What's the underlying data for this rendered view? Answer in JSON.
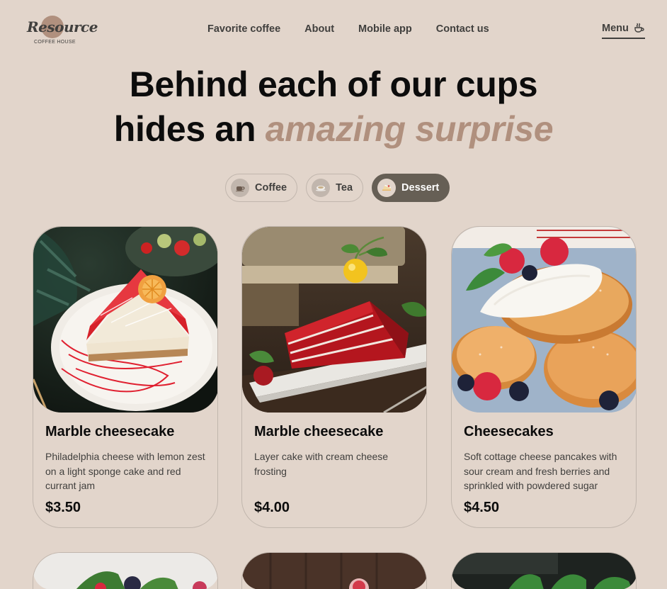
{
  "brand": {
    "name": "Resource",
    "tagline": "COFFEE HOUSE"
  },
  "nav": {
    "items": [
      "Favorite coffee",
      "About",
      "Mobile app",
      "Contact us"
    ]
  },
  "menu_button": {
    "label": "Menu"
  },
  "hero": {
    "line1": "Behind each of our cups",
    "line2_plain": "hides an ",
    "line2_accent": "amazing surprise"
  },
  "tabs": [
    {
      "label": "Coffee",
      "icon": "coffee-cup-icon",
      "active": false
    },
    {
      "label": "Tea",
      "icon": "tea-cup-icon",
      "active": false
    },
    {
      "label": "Dessert",
      "icon": "cake-slice-icon",
      "active": true
    }
  ],
  "products": [
    {
      "title": "Marble cheesecake",
      "description": "Philadelphia cheese with lemon zest on a light sponge cake and red currant jam",
      "price": "$3.50"
    },
    {
      "title": "Marble cheesecake",
      "description": "Layer cake with cream cheese frosting",
      "price": "$4.00"
    },
    {
      "title": "Cheesecakes",
      "description": "Soft cottage cheese pancakes with sour cream and fresh berries and sprinkled with powdered sugar",
      "price": "$4.50"
    }
  ],
  "colors": {
    "background": "#e2d5cb",
    "accent": "#b0907e",
    "text_dark": "#403f3d",
    "border": "#c1b6ad",
    "active_tab": "#665f55"
  }
}
